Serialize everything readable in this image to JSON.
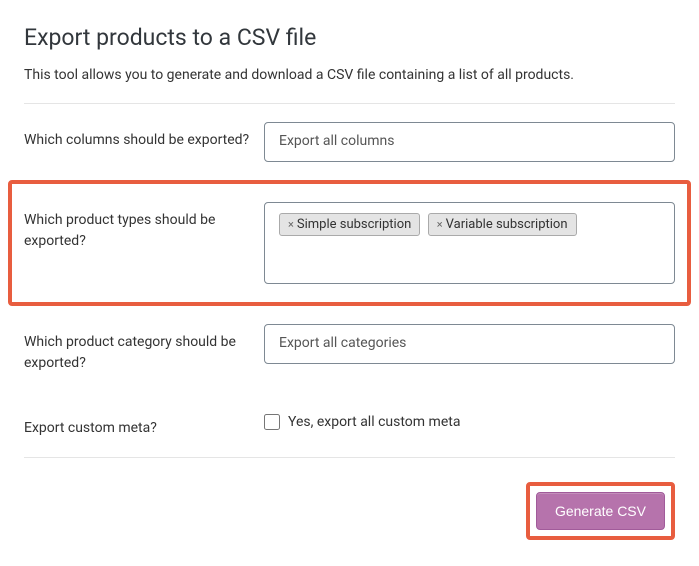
{
  "page": {
    "title": "Export products to a CSV file",
    "description": "This tool allows you to generate and download a CSV file containing a list of all products."
  },
  "form": {
    "columns": {
      "label": "Which columns should be exported?",
      "placeholder": "Export all columns"
    },
    "productTypes": {
      "label": "Which product types should be exported?",
      "tags": [
        {
          "label": "Simple subscription"
        },
        {
          "label": "Variable subscription"
        }
      ]
    },
    "category": {
      "label": "Which product category should be exported?",
      "placeholder": "Export all categories"
    },
    "customMeta": {
      "label": "Export custom meta?",
      "checkboxLabel": "Yes, export all custom meta",
      "checked": false
    },
    "submitButton": "Generate CSV"
  },
  "highlightColor": "#e85d3f"
}
